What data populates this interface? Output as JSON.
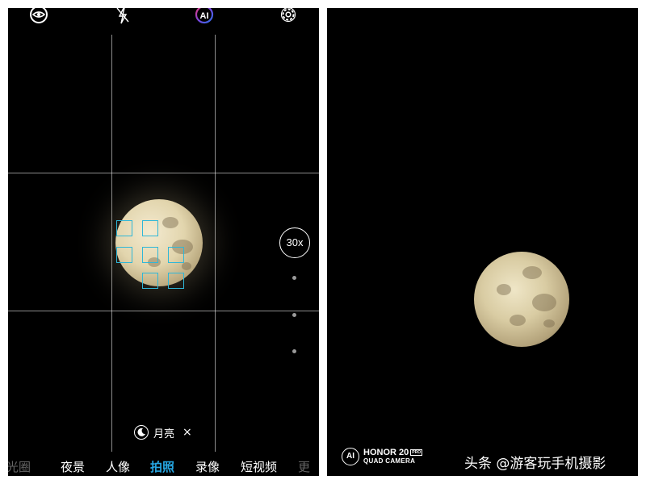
{
  "camera_ui": {
    "top_icons": [
      "hdr-icon",
      "flash-off-icon",
      "ai-icon",
      "gear-icon"
    ],
    "ai_label": "AI",
    "zoom_label": "30x",
    "scene_label": "月亮",
    "scene_close": "×",
    "modes": [
      "光圈",
      "夜景",
      "人像",
      "拍照",
      "录像",
      "短视频",
      "更"
    ],
    "active_mode": "拍照",
    "accent_color": "#26a6e2",
    "focus_color": "#2fb7d8"
  },
  "photo_result": {
    "brand_ai": "AI",
    "brand_model": "HONOR 20",
    "brand_pro": "PRO",
    "brand_camera": "QUAD CAMERA",
    "attribution": "头条 @游客玩手机摄影"
  }
}
